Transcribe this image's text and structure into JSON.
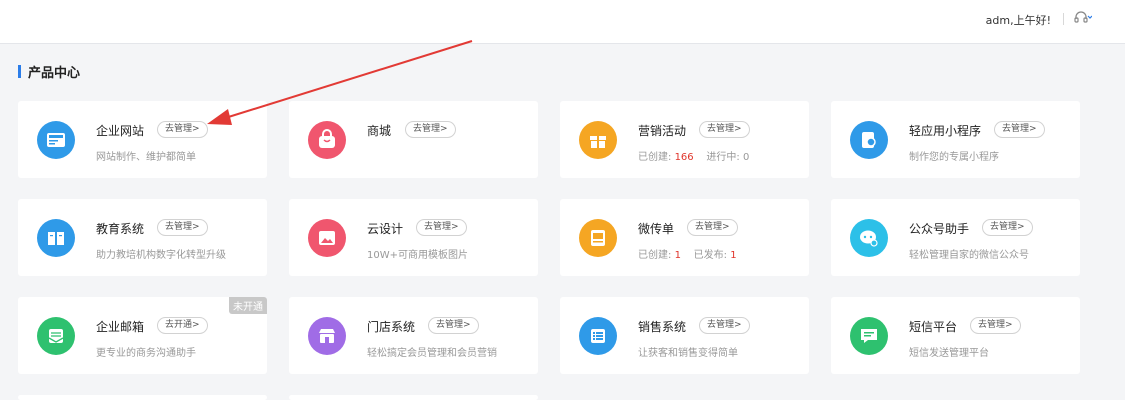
{
  "header": {
    "greeting": "adm,上午好!"
  },
  "section": {
    "title": "产品中心"
  },
  "cards": [
    {
      "name": "企业网站",
      "btn": "去管理>",
      "desc": "网站制作、维护都简单"
    },
    {
      "name": "商城",
      "btn": "去管理>",
      "desc": ""
    },
    {
      "name": "营销活动",
      "btn": "去管理>",
      "stat1_label": "已创建:",
      "stat1_value": "166",
      "stat2_label": "进行中:",
      "stat2_value": "0"
    },
    {
      "name": "轻应用小程序",
      "btn": "去管理>",
      "desc": "制作您的专属小程序"
    },
    {
      "name": "教育系统",
      "btn": "去管理>",
      "desc": "助力教培机构数字化转型升级"
    },
    {
      "name": "云设计",
      "btn": "去管理>",
      "desc": "10W+可商用模板图片"
    },
    {
      "name": "微传单",
      "btn": "去管理>",
      "stat1_label": "已创建:",
      "stat1_value": "1",
      "stat2_label": "已发布:",
      "stat2_value": "1"
    },
    {
      "name": "公众号助手",
      "btn": "去管理>",
      "desc": "轻松管理自家的微信公众号"
    },
    {
      "name": "企业邮箱",
      "btn": "去开通>",
      "desc": "更专业的商务沟通助手",
      "tag": "未开通"
    },
    {
      "name": "门店系统",
      "btn": "去管理>",
      "desc": "轻松搞定会员管理和会员营销"
    },
    {
      "name": "销售系统",
      "btn": "去管理>",
      "desc": "让获客和销售变得简单"
    },
    {
      "name": "短信平台",
      "btn": "去管理>",
      "desc": "短信发送管理平台"
    }
  ],
  "colors": {
    "accent": "#2b7de9",
    "stat_red": "#e0352b",
    "arrow": "#e23a35",
    "icon_blue": "#2f9ae8",
    "icon_pink": "#f0566e",
    "icon_orange": "#f5a623",
    "icon_cyan": "#2cc0e8",
    "icon_green": "#2ec16f",
    "icon_purple": "#a06ce6"
  },
  "icons": [
    "headset-icon",
    "website-icon",
    "shop-bag-icon",
    "gift-icon",
    "mini-program-icon",
    "book-icon",
    "image-icon",
    "flyer-icon",
    "wechat-chat-icon",
    "mail-icon",
    "store-icon",
    "list-icon",
    "sms-icon"
  ]
}
